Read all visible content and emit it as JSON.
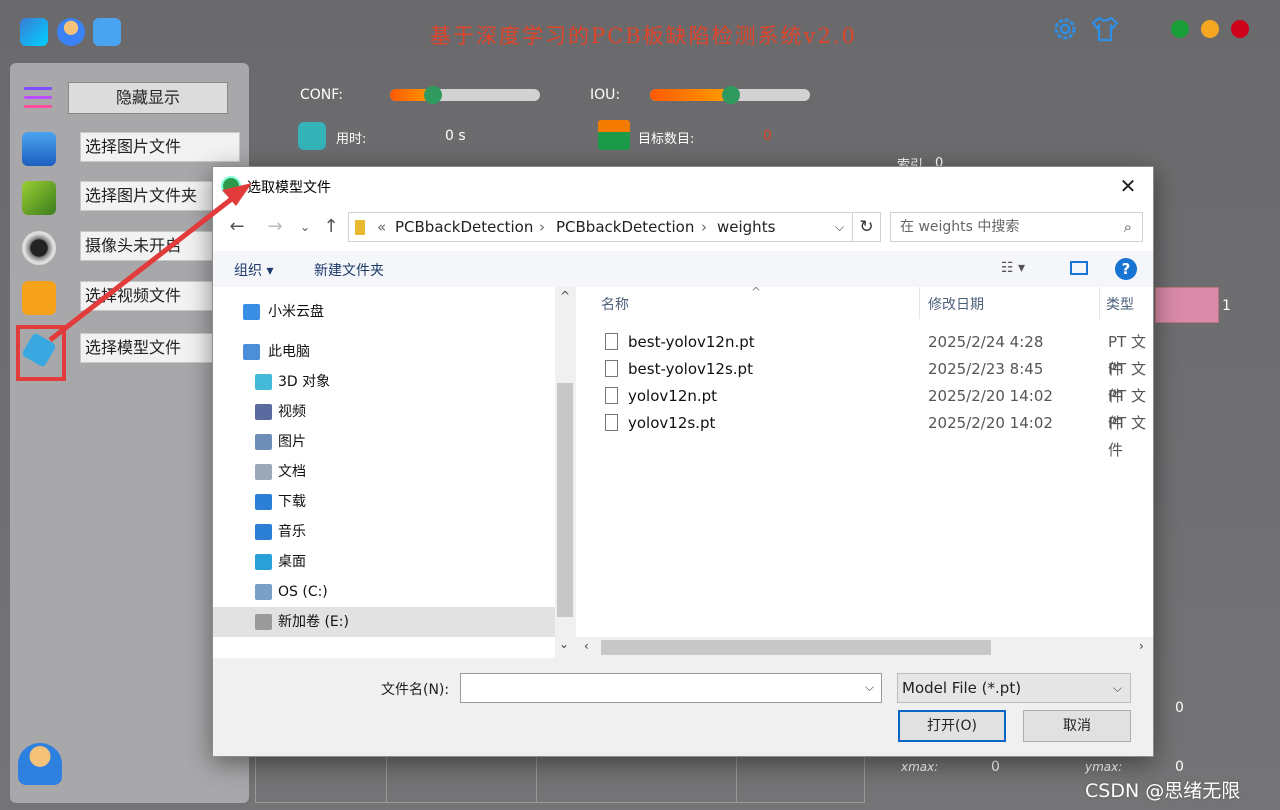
{
  "app": {
    "title": "基于深度学习的PCB板缺陷检测系统v2.0",
    "window_dot_colors": [
      "#1a9e3a",
      "#f5a623",
      "#d0021b"
    ]
  },
  "sidebar": {
    "hide_label": "隐藏显示",
    "items": [
      {
        "label": "选择图片文件",
        "icon": "image-icon"
      },
      {
        "label": "选择图片文件夹",
        "icon": "folder-image-icon"
      },
      {
        "label": "摄像头未开启",
        "icon": "camera-icon"
      },
      {
        "label": "选择视频文件",
        "icon": "video-icon"
      },
      {
        "label": "选择模型文件",
        "icon": "model-cube-icon"
      }
    ]
  },
  "main": {
    "conf_label": "CONF:",
    "conf_value": 0.3,
    "iou_label": "IOU:",
    "iou_value": 0.5,
    "time_label": "用时:",
    "time_value": "0 s",
    "count_label": "目标数目:",
    "count_value": "0",
    "right_index_label": "索引",
    "right_index_value": "0",
    "pink_value": "1",
    "xmax_label": "xmax:",
    "xmax_value": "0",
    "ymax_label": "ymax:",
    "ymax_value": "0",
    "extra_zero": "0"
  },
  "dialog": {
    "title": "选取模型文件",
    "breadcrumb": [
      "«",
      "PCBbackDetection",
      "PCBbackDetection",
      "weights"
    ],
    "search_placeholder": "在 weights 中搜索",
    "organize_label": "组织 ▾",
    "new_folder_label": "新建文件夹",
    "tree": [
      {
        "label": "小米云盘",
        "icon": "cloud-icon",
        "indent": 0
      },
      {
        "label": "此电脑",
        "icon": "computer-icon",
        "indent": 0
      },
      {
        "label": "3D 对象",
        "icon": "3d-objects-icon",
        "indent": 1
      },
      {
        "label": "视频",
        "icon": "videos-folder-icon",
        "indent": 1
      },
      {
        "label": "图片",
        "icon": "pictures-folder-icon",
        "indent": 1
      },
      {
        "label": "文档",
        "icon": "documents-folder-icon",
        "indent": 1
      },
      {
        "label": "下载",
        "icon": "download-icon",
        "indent": 1
      },
      {
        "label": "音乐",
        "icon": "music-icon",
        "indent": 1
      },
      {
        "label": "桌面",
        "icon": "desktop-icon",
        "indent": 1
      },
      {
        "label": "OS (C:)",
        "icon": "drive-c-icon",
        "indent": 1
      },
      {
        "label": "新加卷 (E:)",
        "icon": "drive-e-icon",
        "indent": 1,
        "selected": true
      }
    ],
    "columns": {
      "name": "名称",
      "date": "修改日期",
      "type": "类型"
    },
    "files": [
      {
        "name": "best-yolov12n.pt",
        "date": "2025/2/24 4:28",
        "type": "PT 文件"
      },
      {
        "name": "best-yolov12s.pt",
        "date": "2025/2/23 8:45",
        "type": "PT 文件"
      },
      {
        "name": "yolov12n.pt",
        "date": "2025/2/20 14:02",
        "type": "PT 文件"
      },
      {
        "name": "yolov12s.pt",
        "date": "2025/2/20 14:02",
        "type": "PT 文件"
      }
    ],
    "filename_label": "文件名(N):",
    "filename_value": "",
    "filetype_value": "Model File (*.pt)",
    "open_label": "打开(O)",
    "cancel_label": "取消"
  },
  "watermark": "CSDN @思绪无限",
  "colors": {
    "accent": "#0a66c8",
    "annotation": "#e23b3b",
    "title": "#e0452b"
  }
}
